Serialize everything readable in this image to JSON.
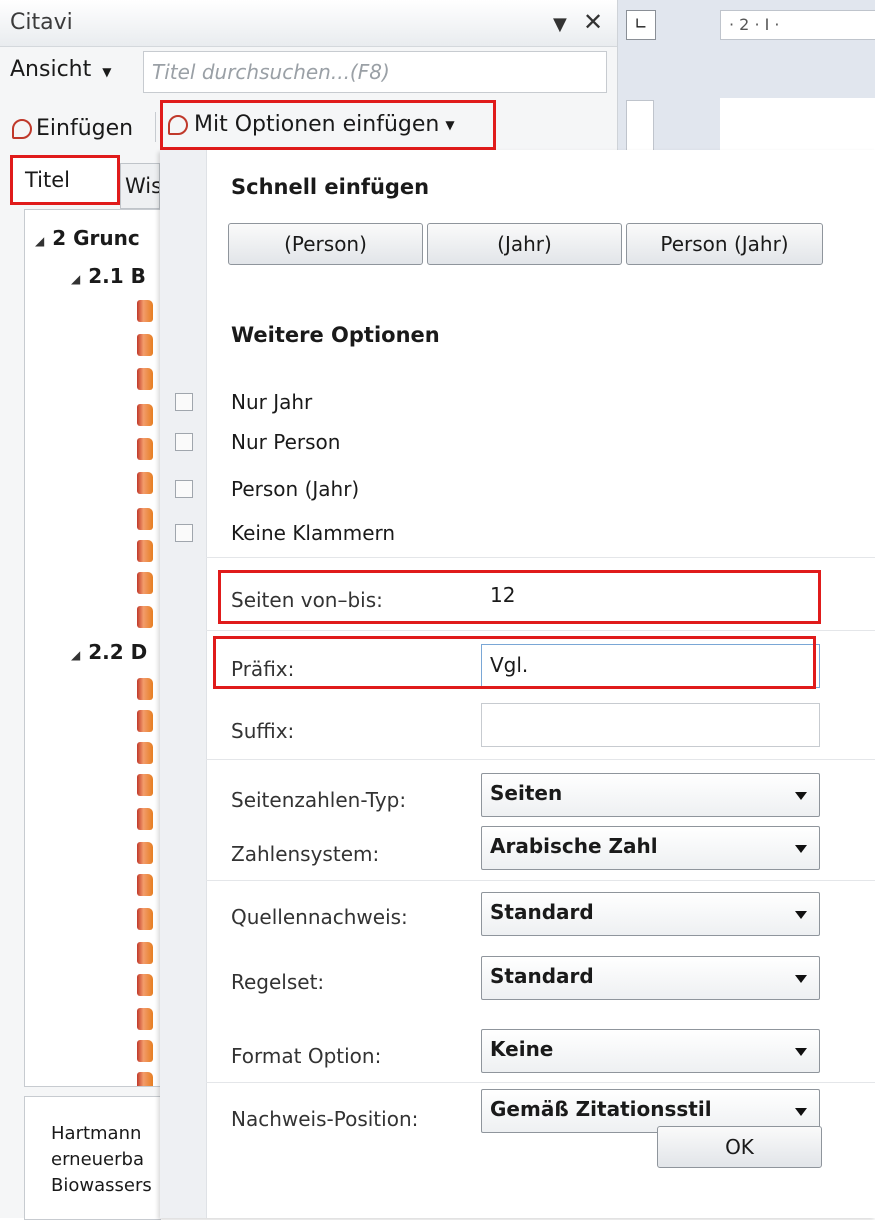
{
  "pane": {
    "title": "Citavi",
    "menu_label": "Ansicht",
    "search_placeholder": "Titel durchsuchen...(F8)",
    "insert_label": "Einfügen",
    "insert_options_label": "Mit Optionen einfügen",
    "tabs": [
      {
        "label": "Titel"
      },
      {
        "label": "Wis"
      }
    ],
    "tree": [
      {
        "label": "2 Grunc"
      },
      {
        "label": "2.1 B"
      },
      {
        "label": "2.2 D"
      }
    ],
    "detail_lines": [
      "Hartmann",
      "erneuerba",
      "Biowassers"
    ]
  },
  "ruler_text": "· 2 · I ·",
  "panel": {
    "quick_header": "Schnell einfügen",
    "quick_buttons": [
      "(Person)",
      "(Jahr)",
      "Person (Jahr)"
    ],
    "more_header": "Weitere Optionen",
    "checkboxes": [
      {
        "label": "Nur Jahr",
        "checked": false
      },
      {
        "label": "Nur Person",
        "checked": false
      },
      {
        "label": "Person (Jahr)",
        "checked": false
      },
      {
        "label": "Keine Klammern",
        "checked": false
      }
    ],
    "pages": {
      "label": "Seiten von–bis:",
      "value": "12"
    },
    "prefix": {
      "label": "Präfix:",
      "value": "Vgl."
    },
    "suffix": {
      "label": "Suffix:",
      "value": ""
    },
    "selects": [
      {
        "label": "Seitenzahlen-Typ:",
        "value": "Seiten"
      },
      {
        "label": "Zahlensystem:",
        "value": "Arabische Zahl"
      },
      {
        "label": "Quellennachweis:",
        "value": "Standard"
      },
      {
        "label": "Regelset:",
        "value": "Standard"
      },
      {
        "label": "Format Option:",
        "value": "Keine"
      },
      {
        "label": "Nachweis-Position:",
        "value": "Gemäß Zitationsstil"
      }
    ],
    "ok_label": "OK"
  },
  "colors": {
    "highlight": "#e01b1b",
    "book_icon": "#e67e22"
  }
}
